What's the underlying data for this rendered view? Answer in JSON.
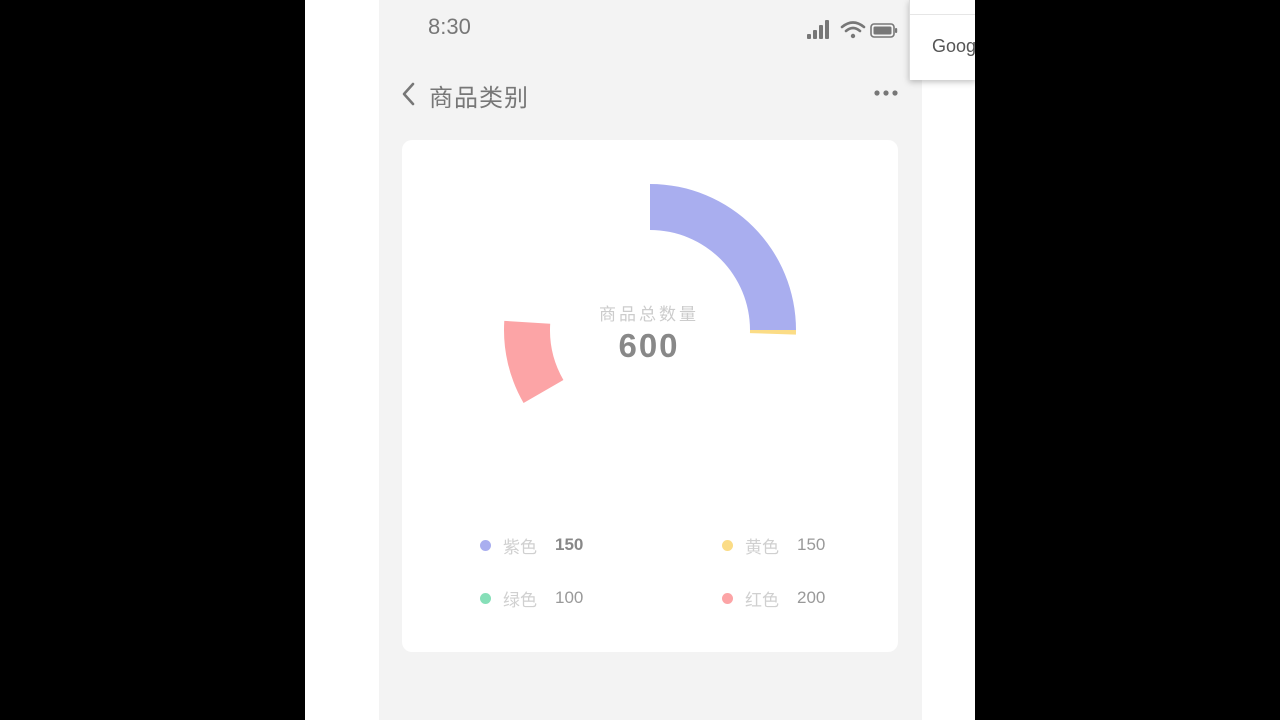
{
  "status_bar": {
    "time": "8:30",
    "icons": [
      "signal-icon",
      "wifi-icon",
      "battery-icon"
    ]
  },
  "nav": {
    "back_icon": "chevron-left-icon",
    "title": "商品类别",
    "more_icon": "more-horizontal-icon"
  },
  "chart_center": {
    "label": "商品总数量",
    "value": "600"
  },
  "legend": [
    {
      "name": "紫色",
      "value": "150",
      "color": "#a9aeef"
    },
    {
      "name": "黄色",
      "value": "150",
      "color": "#fbdc86"
    },
    {
      "name": "绿色",
      "value": "100",
      "color": "#86dfb8"
    },
    {
      "name": "红色",
      "value": "200",
      "color": "#fca4a6"
    }
  ],
  "chart_data": {
    "type": "pie",
    "categories": [
      "紫色",
      "黄色",
      "绿色",
      "红色"
    ],
    "values": [
      150,
      150,
      100,
      200
    ],
    "colors": [
      "#a9aeef",
      "#fbdc86",
      "#86dfb8",
      "#fca4a6"
    ],
    "total": 600,
    "visible_fraction_per_slice": [
      1.0,
      0.02,
      0.0,
      0.28
    ],
    "note_style": "donut"
  },
  "overlay": {
    "google_text": "Goog"
  }
}
